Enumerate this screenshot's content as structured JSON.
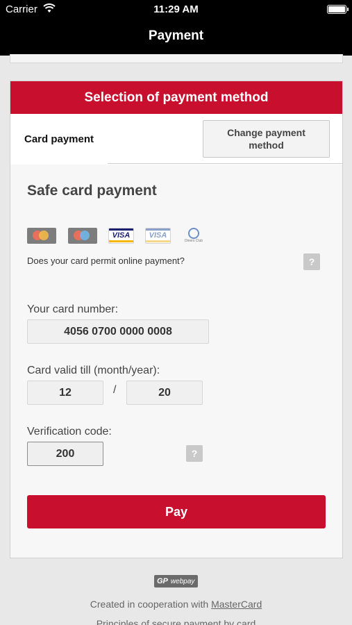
{
  "status_bar": {
    "carrier": "Carrier",
    "wifi_icon": "wifi-icon",
    "time": "11:29 AM",
    "battery_icon": "battery-icon"
  },
  "nav": {
    "title": "Payment"
  },
  "payment": {
    "header": "Selection of payment method",
    "tab_active": "Card payment",
    "tab_change": "Change payment method",
    "title": "Safe card payment",
    "card_logos": [
      "mastercard-logo",
      "maestro-logo",
      "visa-logo",
      "visa-electron-logo",
      "diners-club-logo"
    ],
    "visa_text": "VISA",
    "diners_text": "Diners Club",
    "permit_question": "Does your card permit online payment?",
    "help_symbol": "?",
    "card_number_label": "Your card number:",
    "card_number": "4056 0700 0000 0008",
    "valid_label": "Card valid till (month/year):",
    "month": "12",
    "separator": "/",
    "year": "20",
    "cvc_label": "Verification code:",
    "cvc": "200",
    "pay_label": "Pay"
  },
  "footer": {
    "logo_gp": "GP",
    "logo_webpay": "webpay",
    "cooperation_text": "Created in cooperation with",
    "cooperation_link": "MasterCard",
    "principles_link": "Principles of secure payment by card"
  },
  "colors": {
    "accent": "#c8102e",
    "bar": "#000000",
    "background": "#e8e8e8"
  }
}
